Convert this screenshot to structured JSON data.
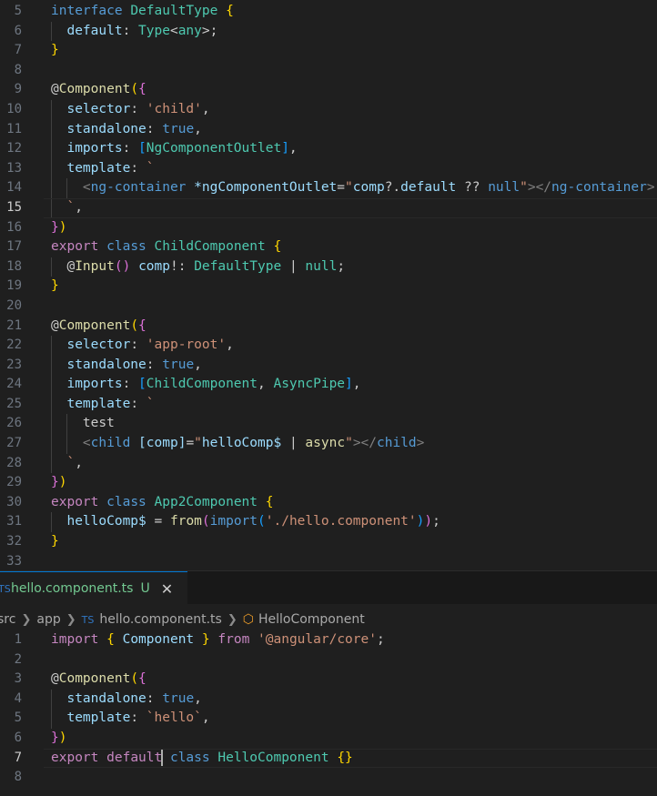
{
  "top_editor": {
    "lines": [
      {
        "n": "5",
        "html": [
          [
            "kw",
            "interface"
          ],
          [
            "pun",
            " "
          ],
          [
            "ty",
            "DefaultType"
          ],
          [
            "pun",
            " "
          ],
          [
            "p1",
            "{"
          ]
        ],
        "indent": 0
      },
      {
        "n": "6",
        "html": [
          [
            "pun",
            "  "
          ],
          [
            "var",
            "default"
          ],
          [
            "pun",
            ": "
          ],
          [
            "ty",
            "Type"
          ],
          [
            "pun",
            "<"
          ],
          [
            "ty",
            "any"
          ],
          [
            "pun",
            ">;"
          ]
        ],
        "indent": 1
      },
      {
        "n": "7",
        "html": [
          [
            "p1",
            "}"
          ]
        ],
        "indent": 0
      },
      {
        "n": "8",
        "html": [],
        "indent": 0
      },
      {
        "n": "9",
        "html": [
          [
            "pun",
            "@"
          ],
          [
            "fn",
            "Component"
          ],
          [
            "p1",
            "("
          ],
          [
            "p2",
            "{"
          ]
        ],
        "indent": 0
      },
      {
        "n": "10",
        "html": [
          [
            "pun",
            "  "
          ],
          [
            "var",
            "selector"
          ],
          [
            "pun",
            ": "
          ],
          [
            "str",
            "'child'"
          ],
          [
            "pun",
            ","
          ]
        ],
        "indent": 1
      },
      {
        "n": "11",
        "html": [
          [
            "pun",
            "  "
          ],
          [
            "var",
            "standalone"
          ],
          [
            "pun",
            ": "
          ],
          [
            "kw",
            "true"
          ],
          [
            "pun",
            ","
          ]
        ],
        "indent": 1
      },
      {
        "n": "12",
        "html": [
          [
            "pun",
            "  "
          ],
          [
            "var",
            "imports"
          ],
          [
            "pun",
            ": "
          ],
          [
            "p3",
            "["
          ],
          [
            "ty",
            "NgComponentOutlet"
          ],
          [
            "p3",
            "]"
          ],
          [
            "pun",
            ","
          ]
        ],
        "indent": 1
      },
      {
        "n": "13",
        "html": [
          [
            "pun",
            "  "
          ],
          [
            "var",
            "template"
          ],
          [
            "pun",
            ": "
          ],
          [
            "str",
            "`"
          ]
        ],
        "indent": 1
      },
      {
        "n": "14",
        "html": [
          [
            "pun",
            "    "
          ],
          [
            "tagb",
            "<"
          ],
          [
            "tag",
            "ng-container"
          ],
          [
            "pun",
            " "
          ],
          [
            "attr",
            "*ngComponentOutlet"
          ],
          [
            "pun",
            "="
          ],
          [
            "str",
            "\""
          ],
          [
            "var",
            "comp"
          ],
          [
            "pun",
            "?."
          ],
          [
            "var",
            "default"
          ],
          [
            "pun",
            " ?? "
          ],
          [
            "kw",
            "null"
          ],
          [
            "str",
            "\""
          ],
          [
            "tagb",
            "></"
          ],
          [
            "tag",
            "ng-container"
          ],
          [
            "tagb",
            ">"
          ]
        ],
        "indent": 2
      },
      {
        "n": "15",
        "html": [
          [
            "pun",
            "  "
          ],
          [
            "str",
            "`"
          ],
          [
            "pun",
            ","
          ]
        ],
        "indent": 1,
        "current": true
      },
      {
        "n": "16",
        "html": [
          [
            "p2",
            "}"
          ],
          [
            "p1",
            ")"
          ]
        ],
        "indent": 0
      },
      {
        "n": "17",
        "html": [
          [
            "ctrl",
            "export"
          ],
          [
            "pun",
            " "
          ],
          [
            "kw",
            "class"
          ],
          [
            "pun",
            " "
          ],
          [
            "ty",
            "ChildComponent"
          ],
          [
            "pun",
            " "
          ],
          [
            "p1",
            "{"
          ]
        ],
        "indent": 0
      },
      {
        "n": "18",
        "html": [
          [
            "pun",
            "  @"
          ],
          [
            "fn",
            "Input"
          ],
          [
            "p2",
            "()"
          ],
          [
            "pun",
            " "
          ],
          [
            "var",
            "comp"
          ],
          [
            "pun",
            "!: "
          ],
          [
            "ty",
            "DefaultType"
          ],
          [
            "pun",
            " | "
          ],
          [
            "ty",
            "null"
          ],
          [
            "pun",
            ";"
          ]
        ],
        "indent": 1
      },
      {
        "n": "19",
        "html": [
          [
            "p1",
            "}"
          ]
        ],
        "indent": 0
      },
      {
        "n": "20",
        "html": [],
        "indent": 0
      },
      {
        "n": "21",
        "html": [
          [
            "pun",
            "@"
          ],
          [
            "fn",
            "Component"
          ],
          [
            "p1",
            "("
          ],
          [
            "p2",
            "{"
          ]
        ],
        "indent": 0
      },
      {
        "n": "22",
        "html": [
          [
            "pun",
            "  "
          ],
          [
            "var",
            "selector"
          ],
          [
            "pun",
            ": "
          ],
          [
            "str",
            "'app-root'"
          ],
          [
            "pun",
            ","
          ]
        ],
        "indent": 1
      },
      {
        "n": "23",
        "html": [
          [
            "pun",
            "  "
          ],
          [
            "var",
            "standalone"
          ],
          [
            "pun",
            ": "
          ],
          [
            "kw",
            "true"
          ],
          [
            "pun",
            ","
          ]
        ],
        "indent": 1
      },
      {
        "n": "24",
        "html": [
          [
            "pun",
            "  "
          ],
          [
            "var",
            "imports"
          ],
          [
            "pun",
            ": "
          ],
          [
            "p3",
            "["
          ],
          [
            "ty",
            "ChildComponent"
          ],
          [
            "pun",
            ", "
          ],
          [
            "ty",
            "AsyncPipe"
          ],
          [
            "p3",
            "]"
          ],
          [
            "pun",
            ","
          ]
        ],
        "indent": 1
      },
      {
        "n": "25",
        "html": [
          [
            "pun",
            "  "
          ],
          [
            "var",
            "template"
          ],
          [
            "pun",
            ": "
          ],
          [
            "str",
            "`"
          ]
        ],
        "indent": 1
      },
      {
        "n": "26",
        "html": [
          [
            "pun",
            "    test"
          ]
        ],
        "indent": 2
      },
      {
        "n": "27",
        "html": [
          [
            "pun",
            "    "
          ],
          [
            "tagb",
            "<"
          ],
          [
            "tag",
            "child"
          ],
          [
            "pun",
            " "
          ],
          [
            "attr",
            "[comp]"
          ],
          [
            "pun",
            "="
          ],
          [
            "str",
            "\""
          ],
          [
            "var",
            "helloComp$"
          ],
          [
            "pun",
            " | "
          ],
          [
            "fn",
            "async"
          ],
          [
            "str",
            "\""
          ],
          [
            "tagb",
            "></"
          ],
          [
            "tag",
            "child"
          ],
          [
            "tagb",
            ">"
          ]
        ],
        "indent": 2
      },
      {
        "n": "28",
        "html": [
          [
            "pun",
            "  "
          ],
          [
            "str",
            "`"
          ],
          [
            "pun",
            ","
          ]
        ],
        "indent": 1
      },
      {
        "n": "29",
        "html": [
          [
            "p2",
            "}"
          ],
          [
            "p1",
            ")"
          ]
        ],
        "indent": 0
      },
      {
        "n": "30",
        "html": [
          [
            "ctrl",
            "export"
          ],
          [
            "pun",
            " "
          ],
          [
            "kw",
            "class"
          ],
          [
            "pun",
            " "
          ],
          [
            "ty",
            "App2Component"
          ],
          [
            "pun",
            " "
          ],
          [
            "p1",
            "{"
          ]
        ],
        "indent": 0
      },
      {
        "n": "31",
        "html": [
          [
            "pun",
            "  "
          ],
          [
            "var",
            "helloComp$"
          ],
          [
            "pun",
            " = "
          ],
          [
            "fn",
            "from"
          ],
          [
            "p2",
            "("
          ],
          [
            "kw",
            "import"
          ],
          [
            "p3",
            "("
          ],
          [
            "str",
            "'./hello.component'"
          ],
          [
            "p3",
            ")"
          ],
          [
            "p2",
            ")"
          ],
          [
            "pun",
            ";"
          ]
        ],
        "indent": 1
      },
      {
        "n": "32",
        "html": [
          [
            "p1",
            "}"
          ]
        ],
        "indent": 0
      },
      {
        "n": "33",
        "html": [],
        "indent": 0
      }
    ]
  },
  "tab": {
    "icon": "TS",
    "name": "hello.component.ts",
    "status": "U",
    "close": "✕"
  },
  "breadcrumb": {
    "items": [
      "src",
      "app",
      "hello.component.ts",
      "HelloComponent"
    ],
    "file_icon": "TS"
  },
  "bottom_editor": {
    "lines": [
      {
        "n": "1",
        "html": [
          [
            "ctrl",
            "import"
          ],
          [
            "pun",
            " "
          ],
          [
            "p1",
            "{"
          ],
          [
            "pun",
            " "
          ],
          [
            "var",
            "Component"
          ],
          [
            "pun",
            " "
          ],
          [
            "p1",
            "}"
          ],
          [
            "pun",
            " "
          ],
          [
            "ctrl",
            "from"
          ],
          [
            "pun",
            " "
          ],
          [
            "str",
            "'@angular/core'"
          ],
          [
            "pun",
            ";"
          ]
        ],
        "indent": 0
      },
      {
        "n": "2",
        "html": [],
        "indent": 0
      },
      {
        "n": "3",
        "html": [
          [
            "pun",
            "@"
          ],
          [
            "fn",
            "Component"
          ],
          [
            "p1",
            "("
          ],
          [
            "p2",
            "{"
          ]
        ],
        "indent": 0
      },
      {
        "n": "4",
        "html": [
          [
            "pun",
            "  "
          ],
          [
            "var",
            "standalone"
          ],
          [
            "pun",
            ": "
          ],
          [
            "kw",
            "true"
          ],
          [
            "pun",
            ","
          ]
        ],
        "indent": 1
      },
      {
        "n": "5",
        "html": [
          [
            "pun",
            "  "
          ],
          [
            "var",
            "template"
          ],
          [
            "pun",
            ": "
          ],
          [
            "str",
            "`hello`"
          ],
          [
            "pun",
            ","
          ]
        ],
        "indent": 1
      },
      {
        "n": "6",
        "html": [
          [
            "p2",
            "}"
          ],
          [
            "p1",
            ")"
          ]
        ],
        "indent": 0
      },
      {
        "n": "7",
        "html": [
          [
            "ctrl",
            "export"
          ],
          [
            "pun",
            " "
          ],
          [
            "ctrl",
            "default"
          ],
          [
            "cursor",
            ""
          ],
          [
            "pun",
            " "
          ],
          [
            "kw",
            "class"
          ],
          [
            "pun",
            " "
          ],
          [
            "ty",
            "HelloComponent"
          ],
          [
            "pun",
            " "
          ],
          [
            "p1",
            "{}"
          ]
        ],
        "indent": 0,
        "current": true
      },
      {
        "n": "8",
        "html": [],
        "indent": 0
      }
    ]
  }
}
